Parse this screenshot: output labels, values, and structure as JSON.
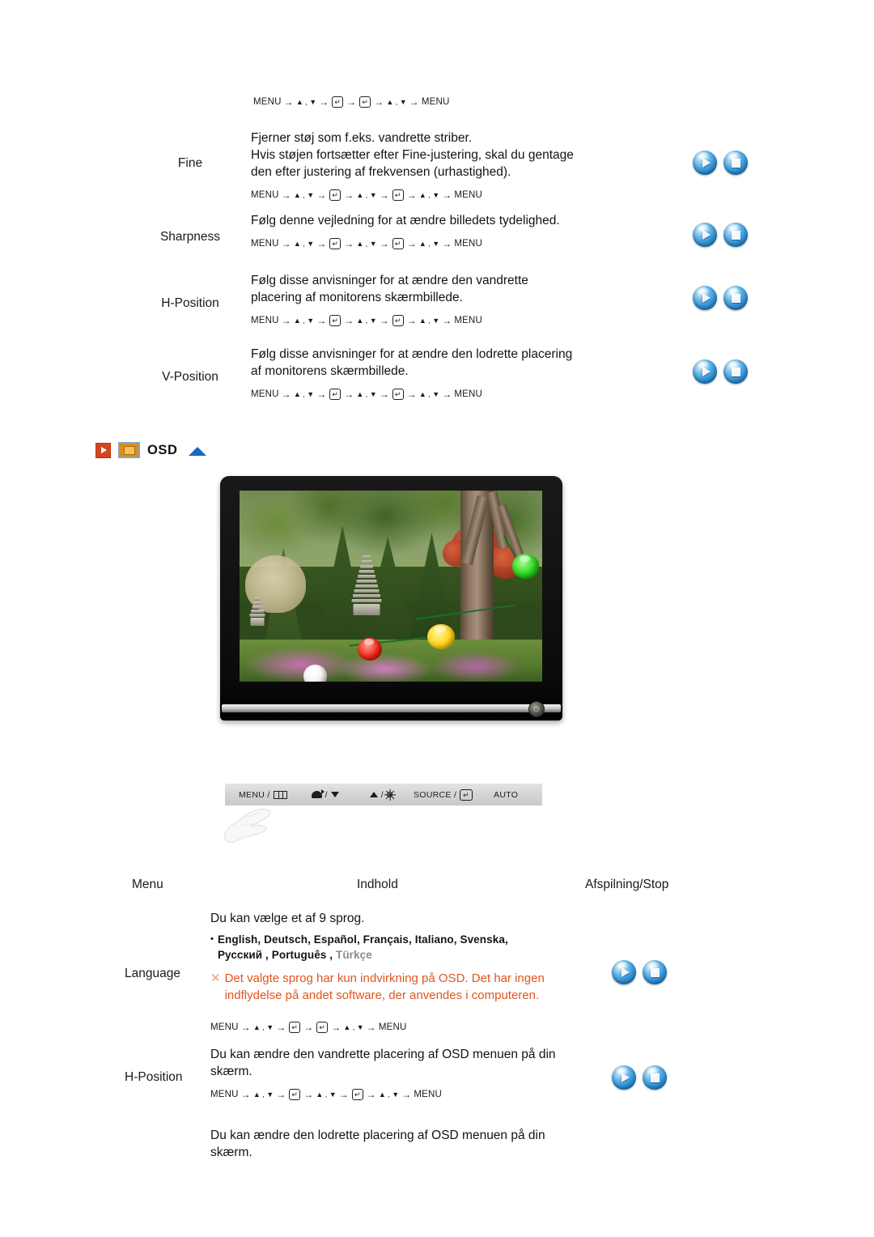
{
  "nav_paths": {
    "long": [
      "MENU",
      "▲ , ▼",
      "enter",
      "▲ , ▼",
      "enter",
      "▲ , ▼",
      "MENU"
    ],
    "short": [
      "MENU",
      "▲ , ▼",
      "enter",
      "enter",
      "▲ , ▼",
      "MENU"
    ],
    "menu_label": "MENU",
    "updown_label": "▲ , ▼",
    "arrow": "→",
    "enter_glyph": "↵"
  },
  "top_section": {
    "intro_navpath_type": "long",
    "rows": [
      {
        "menu": "Fine",
        "description": "Fjerner støj som f.eks. vandrette striber.\nHvis støjen fortsætter efter Fine-justering, skal du gentage\nden efter justering af frekvensen (urhastighed).",
        "navpath": "long",
        "buttons": [
          "play",
          "stop"
        ]
      },
      {
        "menu": "Sharpness",
        "description": "Følg denne vejledning for at ændre billedets tydelighed.",
        "navpath": "long",
        "buttons": [
          "play",
          "stop"
        ]
      },
      {
        "menu": "H-Position",
        "description": "Følg disse anvisninger for at ændre den vandrette\nplacering af monitorens skærmbillede.",
        "navpath": "long",
        "buttons": [
          "play",
          "stop"
        ]
      },
      {
        "menu": "V-Position",
        "description": "Følg disse anvisninger for at ændre den lodrette placering\naf monitorens skærmbillede.",
        "navpath": "long",
        "buttons": [
          "play",
          "stop"
        ]
      }
    ]
  },
  "osd_section": {
    "title": "OSD",
    "icons": [
      "play-box-icon",
      "monitor-icon",
      "up-triangle-icon"
    ],
    "accent_orange": "#d3451c",
    "accent_blue": "#1668c7"
  },
  "monitor": {
    "screen_alt": "garden-photo",
    "power_glyph": "⏻"
  },
  "control_bar": {
    "buttons": [
      {
        "label": "MENU /",
        "icon": "menu-bars-icon"
      },
      {
        "label": "/",
        "icon": "speaker-icon",
        "icon2": "down-triangle-icon"
      },
      {
        "label": "/",
        "icon": "up-triangle-icon",
        "icon2": "brightness-sun-icon"
      },
      {
        "label": "SOURCE /",
        "icon": "enter-key-icon"
      },
      {
        "label": "AUTO",
        "icon": ""
      }
    ],
    "menu_label": "MENU /",
    "source_label": "SOURCE /",
    "auto_label": "AUTO",
    "slash": "/"
  },
  "table": {
    "headers": {
      "menu": "Menu",
      "content": "Indhold",
      "playstop": "Afspilning/Stop"
    },
    "rows": [
      {
        "menu": "Language",
        "intro": "Du kan vælge et af 9 sprog.",
        "languages_line1": "English, Deutsch, Español, Français,  Italiano, Svenska,",
        "languages_line2a": "Русский , Português , ",
        "languages_line2b": "Türkçe",
        "bullet": "•",
        "warning_marker": "✕",
        "warning": "Det valgte sprog har kun indvirkning på OSD. Det har ingen\nindflydelse på andet software, der anvendes i computeren.",
        "navpath": "short",
        "buttons": [
          "play",
          "stop"
        ]
      },
      {
        "menu": "H-Position",
        "description": "Du kan ændre den vandrette placering af OSD menuen på din\nskærm.",
        "navpath": "long",
        "buttons": [
          "play",
          "stop"
        ]
      },
      {
        "menu": "",
        "description": "Du kan ændre den lodrette placering af OSD menuen på din\nskærm.",
        "navpath": "",
        "buttons": []
      }
    ]
  }
}
